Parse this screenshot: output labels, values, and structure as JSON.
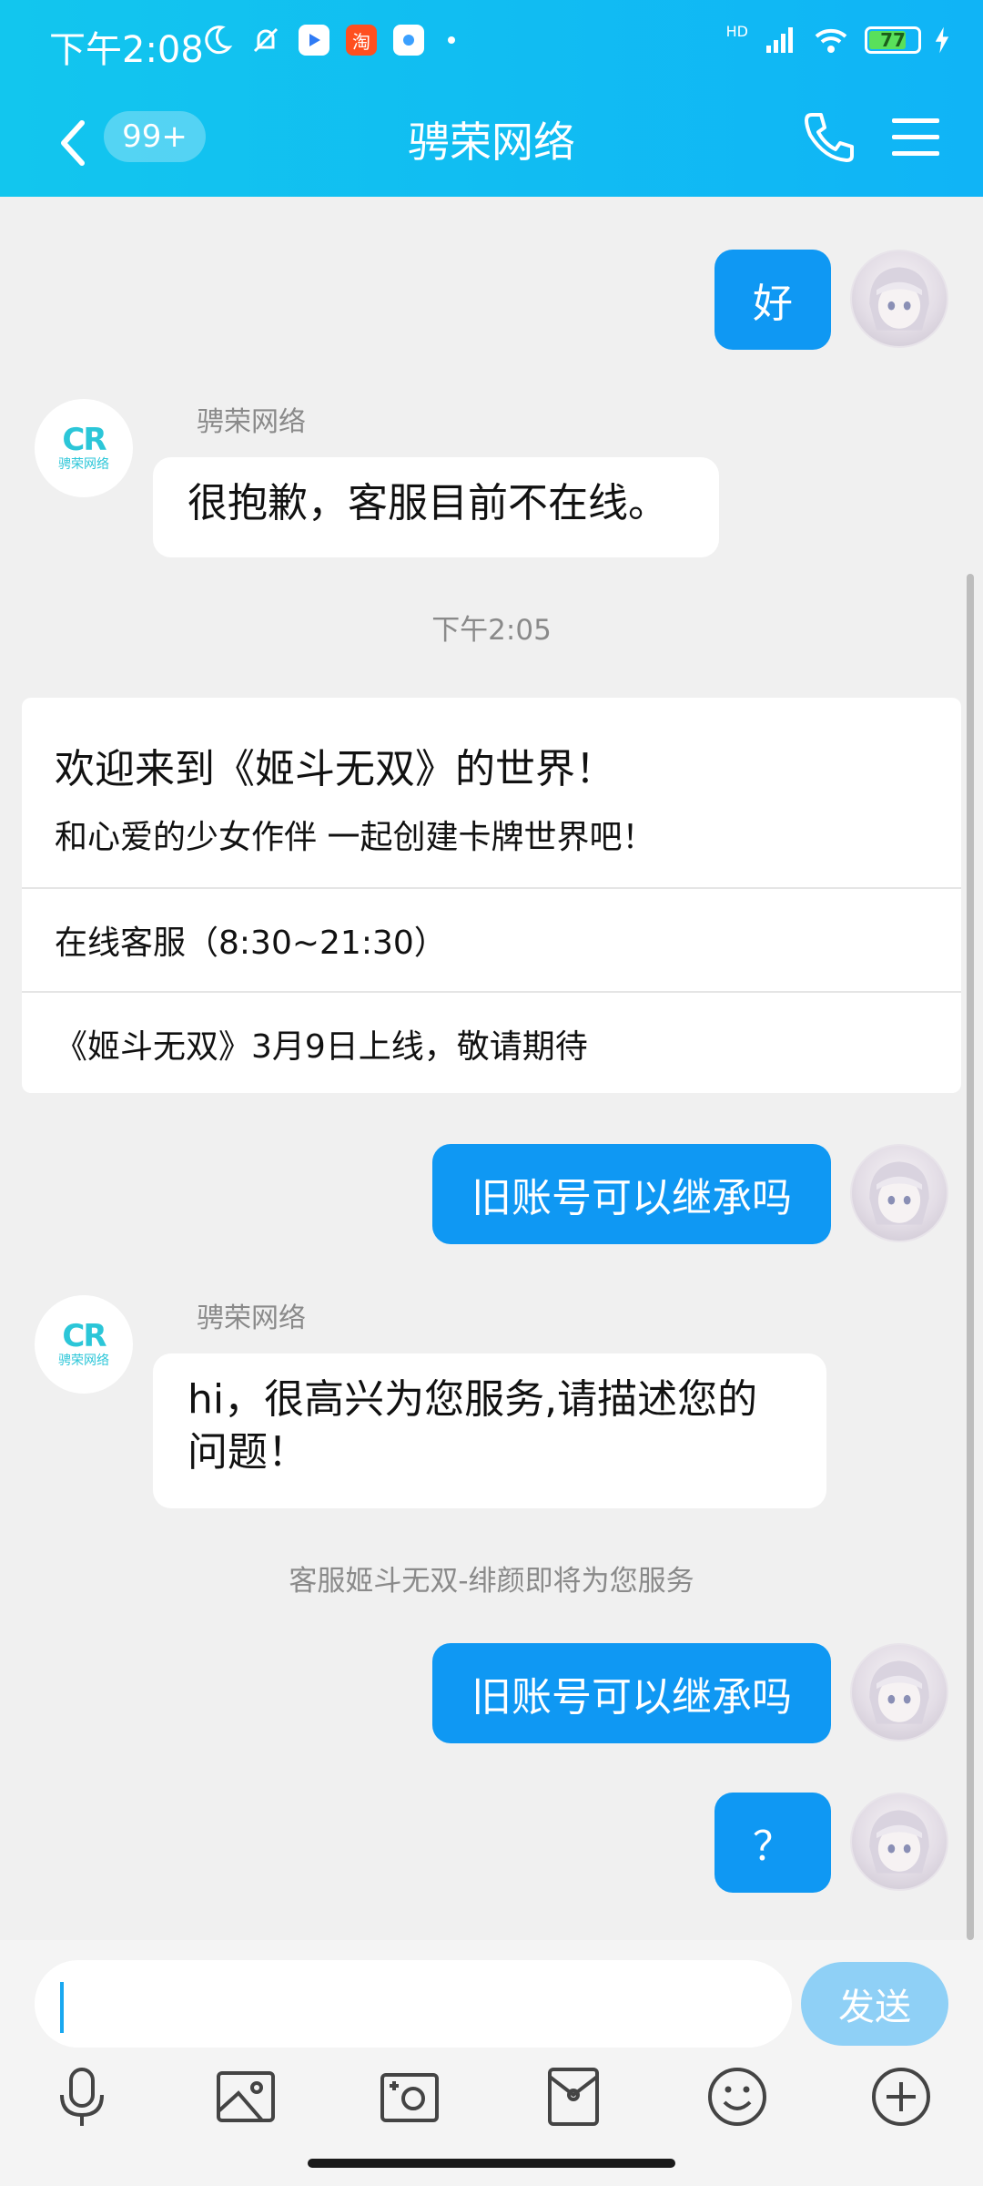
{
  "status_bar": {
    "time": "下午2:08",
    "battery_level": "77",
    "battery_fraction": 0.77,
    "network_label": "HD",
    "app_icon_taobao_text": "淘"
  },
  "nav": {
    "title": "骋荣网络",
    "unread_badge": "99+"
  },
  "messages": [
    {
      "direction": "out",
      "text": "好"
    },
    {
      "direction": "in",
      "sender": "骋荣网络",
      "text": "很抱歉，客服目前不在线。"
    },
    {
      "type": "timestamp",
      "text": "下午2:05"
    },
    {
      "type": "card",
      "title": "欢迎来到《姬斗无双》的世界！",
      "subtitle": "和心爱的少女作伴  一起创建卡牌世界吧！",
      "links": [
        "在线客服（8:30~21:30）",
        "《姬斗无双》3月9日上线，敬请期待"
      ]
    },
    {
      "direction": "out",
      "text": "旧账号可以继承吗"
    },
    {
      "direction": "in",
      "sender": "骋荣网络",
      "text": "hi，很高兴为您服务,请描述您的问题！"
    },
    {
      "type": "notice",
      "text": "客服姬斗无双-绯颜即将为您服务"
    },
    {
      "direction": "out",
      "text": "旧账号可以继承吗"
    },
    {
      "direction": "out",
      "text": "？"
    }
  ],
  "logo": {
    "mark": "CR",
    "caption": "骋荣网络"
  },
  "input": {
    "value": "",
    "send_label": "发送"
  },
  "toolbar": [
    "microphone-icon",
    "image-icon",
    "camera-icon",
    "red-packet-icon",
    "emoji-icon",
    "plus-icon"
  ],
  "colors": {
    "header": "#10b4f6",
    "bubble_out": "#0f98f3",
    "send_button": "#8fd0f6"
  }
}
